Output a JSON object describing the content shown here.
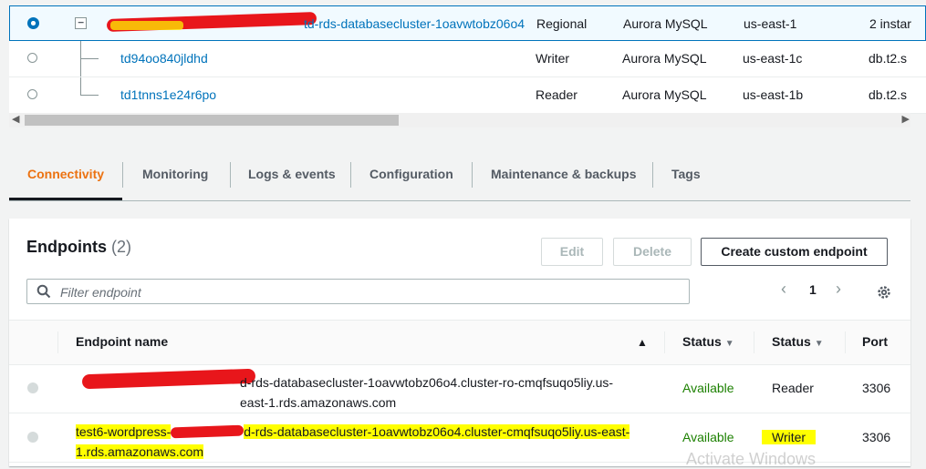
{
  "instances": [
    {
      "name": "td-rds-databasecluster-1oavwtobz06o4",
      "role": "Regional",
      "engine": "Aurora MySQL",
      "region": "us-east-1",
      "size": "2 instar",
      "selected": true
    },
    {
      "name": "td94oo840jldhd",
      "role": "Writer",
      "engine": "Aurora MySQL",
      "region": "us-east-1c",
      "size": "db.t2.s",
      "selected": false
    },
    {
      "name": "td1tnns1e24r6po",
      "role": "Reader",
      "engine": "Aurora MySQL",
      "region": "us-east-1b",
      "size": "db.t2.s",
      "selected": false
    }
  ],
  "tabs": [
    "Connectivity",
    "Monitoring",
    "Logs & events",
    "Configuration",
    "Maintenance & backups",
    "Tags"
  ],
  "endpoints": {
    "title": "Endpoints",
    "count": "(2)",
    "edit_label": "Edit",
    "delete_label": "Delete",
    "create_label": "Create custom endpoint",
    "filter_placeholder": "Filter endpoint",
    "page": "1",
    "columns": {
      "name": "Endpoint name",
      "status": "Status",
      "type": "Status",
      "port": "Port"
    },
    "rows": [
      {
        "name_prefix": "",
        "name_suffix": "d-rds-databasecluster-1oavwtobz06o4.cluster-ro-cmqfsuqo5liy.us-east-1.rds.amazonaws.com",
        "status": "Available",
        "type": "Reader",
        "port": "3306"
      },
      {
        "name_prefix": "test6-wordpress-",
        "name_suffix": "d-rds-databasecluster-1oavwtobz06o4.cluster-cmqfsuqo5liy.us-east-1.rds.amazonaws.com",
        "status": "Available",
        "type": "Writer",
        "port": "3306"
      }
    ]
  },
  "watermark": "Activate Windows",
  "colors": {
    "accent": "#0073bb",
    "active_tab": "#ec7211",
    "available": "#1d8102",
    "highlight": "#ffff00",
    "redaction": "#e8161b"
  }
}
